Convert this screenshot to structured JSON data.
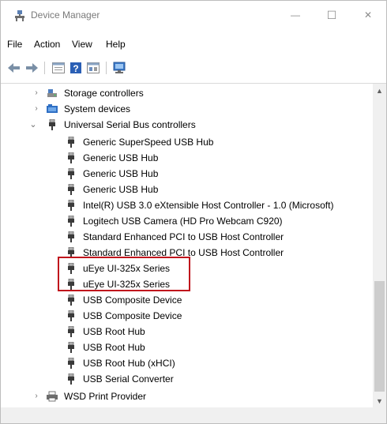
{
  "window": {
    "title": "Device Manager",
    "min_symbol": "—",
    "max_symbol": "☐",
    "close_symbol": "✕"
  },
  "menu": {
    "items": [
      "File",
      "Action",
      "View",
      "Help"
    ]
  },
  "toolbar": {
    "icons": [
      "back-arrow-icon",
      "forward-arrow-icon",
      "properties-icon",
      "help-icon",
      "update-driver-icon",
      "scan-hardware-icon"
    ]
  },
  "tree": {
    "categories": [
      {
        "label": "Storage controllers",
        "state": "collapsed",
        "icon": "storage-controller-icon"
      },
      {
        "label": "System devices",
        "state": "collapsed",
        "icon": "system-devices-icon"
      },
      {
        "label": "Universal Serial Bus controllers",
        "state": "expanded",
        "icon": "usb-icon"
      }
    ],
    "usb_devices": [
      "Generic SuperSpeed USB Hub",
      "Generic USB Hub",
      "Generic USB Hub",
      "Generic USB Hub",
      "Intel(R) USB 3.0 eXtensible Host Controller - 1.0 (Microsoft)",
      "Logitech USB Camera (HD Pro Webcam C920)",
      "Standard Enhanced PCI to USB Host Controller",
      "Standard Enhanced PCI to USB Host Controller",
      "uEye UI-325x Series",
      "uEye UI-325x Series",
      "USB Composite Device",
      "USB Composite Device",
      "USB Root Hub",
      "USB Root Hub",
      "USB Root Hub (xHCI)",
      "USB Serial Converter"
    ],
    "trailing_category": {
      "label": "WSD Print Provider",
      "state": "collapsed",
      "icon": "printer-icon"
    }
  },
  "colors": {
    "highlight": "#c0141c",
    "title_text": "#7a7a7a"
  }
}
